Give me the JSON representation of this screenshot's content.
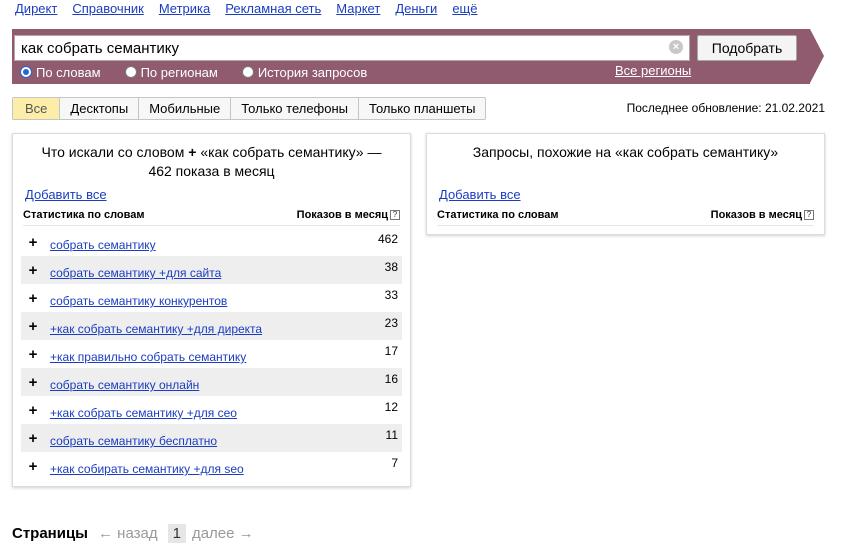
{
  "topnav": [
    "Директ",
    "Справочник",
    "Метрика",
    "Рекламная сеть",
    "Маркет",
    "Деньги",
    "ещё"
  ],
  "search": {
    "value": "как собрать семантику",
    "clear": "×",
    "submit": "Подобрать"
  },
  "radios": [
    {
      "label": "По словам",
      "checked": true
    },
    {
      "label": "По регионам",
      "checked": false
    },
    {
      "label": "История запросов",
      "checked": false
    }
  ],
  "region_link": "Все регионы",
  "tabs": [
    "Все",
    "Десктопы",
    "Мобильные",
    "Только телефоны",
    "Только планшеты"
  ],
  "updated": "Последнее обновление: 21.02.2021",
  "left_panel": {
    "title_a": "Что искали со словом",
    "title_plus": "+",
    "title_b": "«как собрать семантику» — 462 показа в месяц",
    "add_all": "Добавить все",
    "col_words": "Статистика по словам",
    "col_shows": "Показов в месяц",
    "help": "?",
    "rows": [
      {
        "phrase": "собрать семантику",
        "count": "462"
      },
      {
        "phrase": "собрать семантику +для сайта",
        "count": "38"
      },
      {
        "phrase": "собрать семантику конкурентов",
        "count": "33"
      },
      {
        "phrase": "+как собрать семантику +для директа",
        "count": "23"
      },
      {
        "phrase": "+как правильно собрать семантику",
        "count": "17"
      },
      {
        "phrase": "собрать семантику онлайн",
        "count": "16"
      },
      {
        "phrase": "+как собрать семантику +для сео",
        "count": "12"
      },
      {
        "phrase": "собрать семантику бесплатно",
        "count": "11"
      },
      {
        "phrase": "+как собирать семантику +для seo",
        "count": "7"
      }
    ]
  },
  "right_panel": {
    "title": "Запросы, похожие на «как собрать семантику»",
    "add_all": "Добавить все",
    "col_words": "Статистика по словам",
    "col_shows": "Показов в месяц",
    "help": "?"
  },
  "pager": {
    "label": "Страницы",
    "prev": "← назад",
    "current": "1",
    "next": "далее →"
  },
  "colors": {
    "brand": "#905b6e",
    "link": "#1a3dc1",
    "active_tab": "#fceea8"
  }
}
